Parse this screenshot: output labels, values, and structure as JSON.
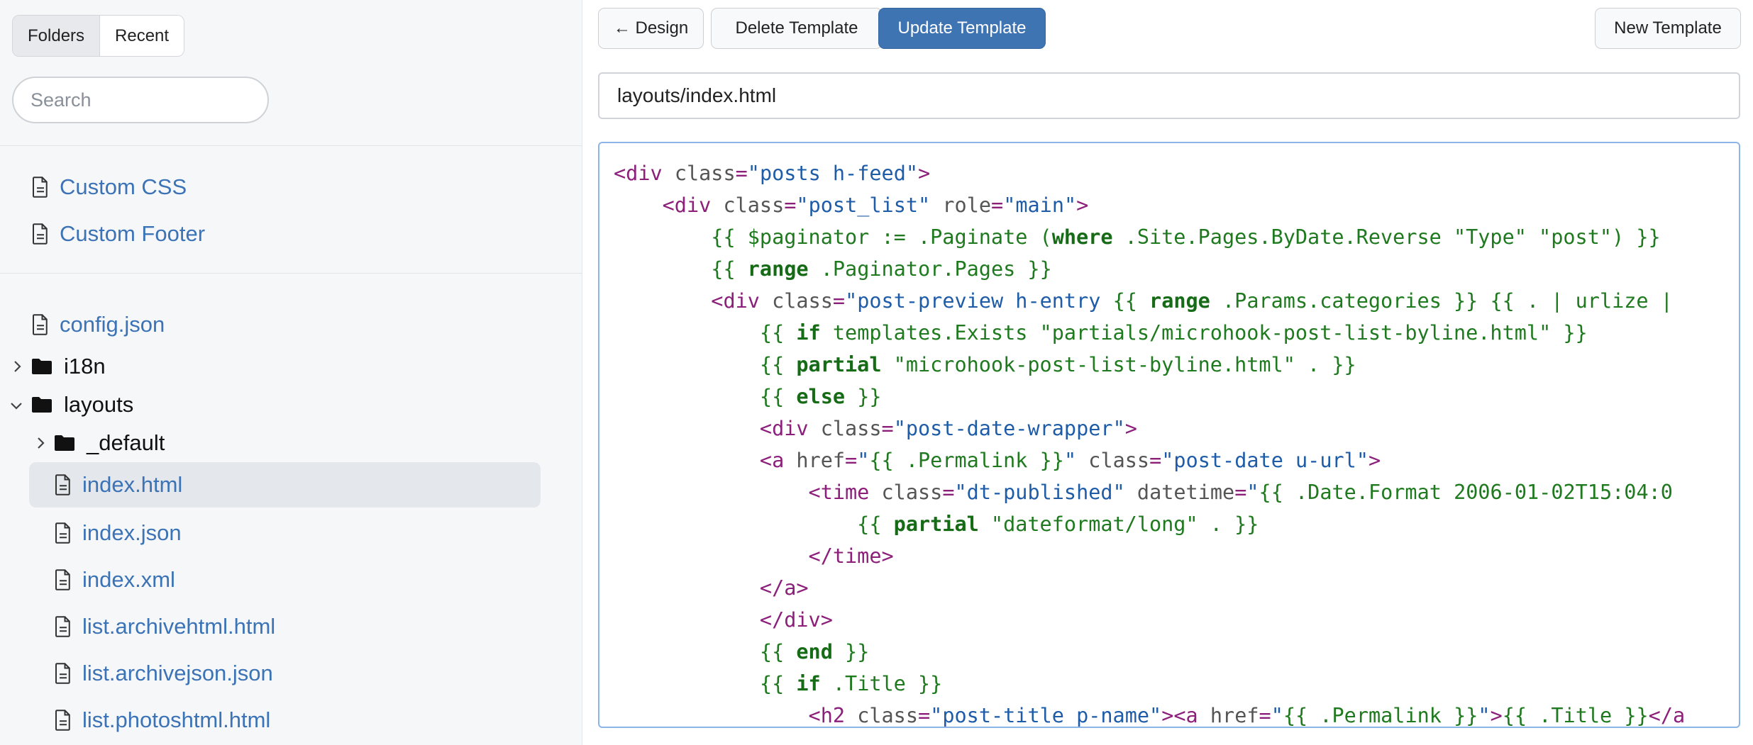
{
  "sidebar": {
    "tabs": [
      {
        "label": "Folders",
        "active": true
      },
      {
        "label": "Recent",
        "active": false
      }
    ],
    "search_placeholder": "Search",
    "pinned": [
      {
        "label": "Custom CSS",
        "icon": "file-icon"
      },
      {
        "label": "Custom Footer",
        "icon": "file-icon"
      }
    ],
    "tree": [
      {
        "label": "config.json",
        "type": "file"
      },
      {
        "label": "i18n",
        "type": "folder",
        "expanded": false
      },
      {
        "label": "layouts",
        "type": "folder",
        "expanded": true
      },
      {
        "label": "_default",
        "type": "folder",
        "expanded": false
      },
      {
        "label": "index.html",
        "type": "file",
        "selected": true
      },
      {
        "label": "index.json",
        "type": "file"
      },
      {
        "label": "index.xml",
        "type": "file"
      },
      {
        "label": "list.archivehtml.html",
        "type": "file"
      },
      {
        "label": "list.archivejson.json",
        "type": "file"
      },
      {
        "label": "list.photoshtml.html",
        "type": "file"
      }
    ]
  },
  "toolbar": {
    "design_label": "← Design",
    "delete_label": "Delete Template",
    "update_label": "Update Template",
    "new_label": "New Template"
  },
  "editor": {
    "path": "layouts/index.html",
    "code_lines": [
      "<div class=\"posts h-feed\">",
      "    <div class=\"post_list\" role=\"main\">",
      "        {{ $paginator := .Paginate (where .Site.Pages.ByDate.Reverse \"Type\" \"post\") }}",
      "        {{ range .Paginator.Pages }}",
      "        <div class=\"post-preview h-entry {{ range .Params.categories }} {{ . | urlize |",
      "            {{ if templates.Exists \"partials/microhook-post-list-byline.html\" }}",
      "            {{ partial \"microhook-post-list-byline.html\" . }}",
      "            {{ else }}",
      "            <div class=\"post-date-wrapper\">",
      "            <a href=\"{{ .Permalink }}\" class=\"post-date u-url\">",
      "                <time class=\"dt-published\" datetime=\"{{ .Date.Format \"2006-01-02T15:04:0",
      "                    {{ partial \"dateformat/long\" . }}",
      "                </time>",
      "            </a>",
      "            </div>",
      "            {{ end }}",
      "            {{ if .Title }}",
      "                <h2 class=\"post-title p-name\"><a href=\"{{ .Permalink }}\">{{ .Title }}</a"
    ]
  },
  "colors": {
    "primary_button": "#3f74b3",
    "link": "#3b73b6",
    "editor_focus_border": "#8db4e6",
    "tag": "#8b1f7a",
    "string": "#1f5ca8",
    "template": "#1f7a1f"
  }
}
